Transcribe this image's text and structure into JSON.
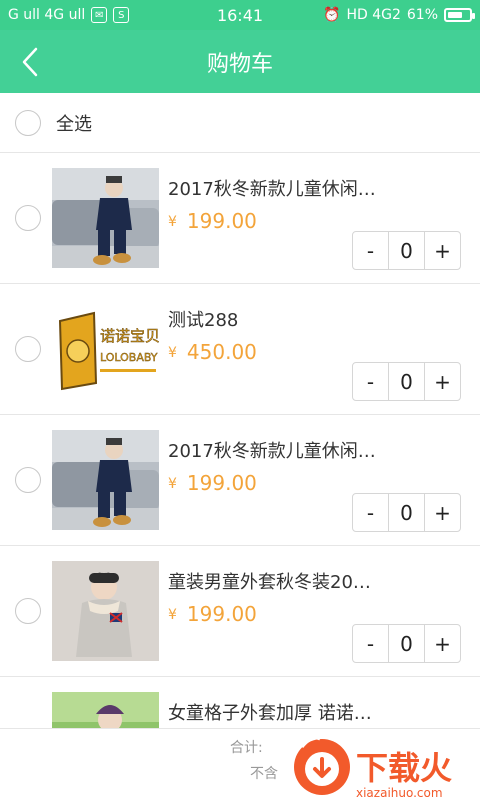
{
  "status_bar": {
    "carrier_text": "G ull 4G ull",
    "time": "16:41",
    "network": "HD 4G2",
    "battery": "61%"
  },
  "header": {
    "back_icon": "chevron-left-icon",
    "title": "购物车"
  },
  "select_all": {
    "label": "全选"
  },
  "items": [
    {
      "name": "2017秋冬新款儿童休闲…",
      "currency": "¥",
      "price": "199.00",
      "quantity": "0",
      "minus": "-",
      "plus": "+"
    },
    {
      "name": "测试288",
      "currency": "¥",
      "price": "450.00",
      "quantity": "0",
      "minus": "-",
      "plus": "+",
      "logo_text": "诺诺宝贝",
      "logo_sub": "LOLOBABY"
    },
    {
      "name": "2017秋冬新款儿童休闲…",
      "currency": "¥",
      "price": "199.00",
      "quantity": "0",
      "minus": "-",
      "plus": "+"
    },
    {
      "name": "童装男童外套秋冬装20…",
      "currency": "¥",
      "price": "199.00",
      "quantity": "0",
      "minus": "-",
      "plus": "+"
    },
    {
      "name": "女童格子外套加厚 诺诺…"
    }
  ],
  "bottom": {
    "total_label": "合计:",
    "sub_label": "不含"
  },
  "watermark": {
    "text": "下载火",
    "url_text": "xiazaihuo.com"
  },
  "colors": {
    "accent": "#43d096",
    "price": "#f3a43a"
  }
}
